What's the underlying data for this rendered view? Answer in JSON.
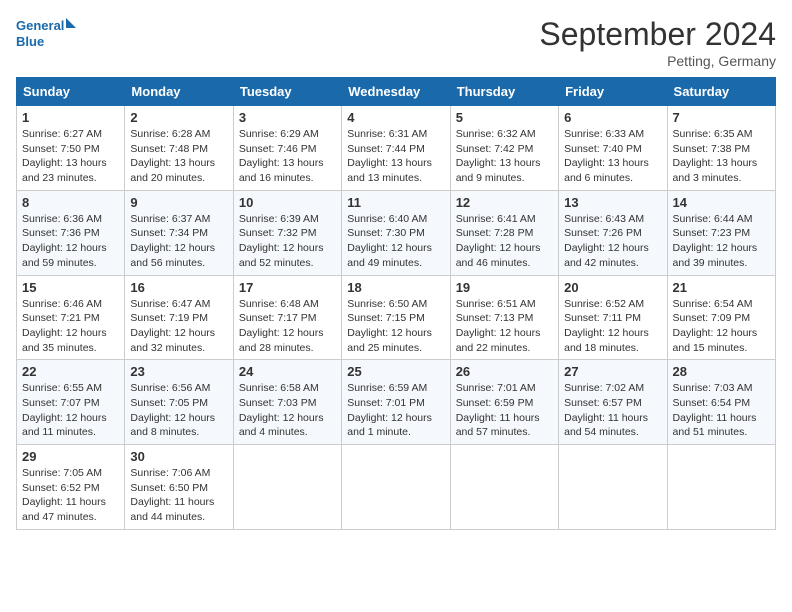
{
  "header": {
    "logo_line1": "General",
    "logo_line2": "Blue",
    "month_title": "September 2024",
    "location": "Petting, Germany"
  },
  "days_of_week": [
    "Sunday",
    "Monday",
    "Tuesday",
    "Wednesday",
    "Thursday",
    "Friday",
    "Saturday"
  ],
  "weeks": [
    [
      {
        "day": "1",
        "info": "Sunrise: 6:27 AM\nSunset: 7:50 PM\nDaylight: 13 hours\nand 23 minutes."
      },
      {
        "day": "2",
        "info": "Sunrise: 6:28 AM\nSunset: 7:48 PM\nDaylight: 13 hours\nand 20 minutes."
      },
      {
        "day": "3",
        "info": "Sunrise: 6:29 AM\nSunset: 7:46 PM\nDaylight: 13 hours\nand 16 minutes."
      },
      {
        "day": "4",
        "info": "Sunrise: 6:31 AM\nSunset: 7:44 PM\nDaylight: 13 hours\nand 13 minutes."
      },
      {
        "day": "5",
        "info": "Sunrise: 6:32 AM\nSunset: 7:42 PM\nDaylight: 13 hours\nand 9 minutes."
      },
      {
        "day": "6",
        "info": "Sunrise: 6:33 AM\nSunset: 7:40 PM\nDaylight: 13 hours\nand 6 minutes."
      },
      {
        "day": "7",
        "info": "Sunrise: 6:35 AM\nSunset: 7:38 PM\nDaylight: 13 hours\nand 3 minutes."
      }
    ],
    [
      {
        "day": "8",
        "info": "Sunrise: 6:36 AM\nSunset: 7:36 PM\nDaylight: 12 hours\nand 59 minutes."
      },
      {
        "day": "9",
        "info": "Sunrise: 6:37 AM\nSunset: 7:34 PM\nDaylight: 12 hours\nand 56 minutes."
      },
      {
        "day": "10",
        "info": "Sunrise: 6:39 AM\nSunset: 7:32 PM\nDaylight: 12 hours\nand 52 minutes."
      },
      {
        "day": "11",
        "info": "Sunrise: 6:40 AM\nSunset: 7:30 PM\nDaylight: 12 hours\nand 49 minutes."
      },
      {
        "day": "12",
        "info": "Sunrise: 6:41 AM\nSunset: 7:28 PM\nDaylight: 12 hours\nand 46 minutes."
      },
      {
        "day": "13",
        "info": "Sunrise: 6:43 AM\nSunset: 7:26 PM\nDaylight: 12 hours\nand 42 minutes."
      },
      {
        "day": "14",
        "info": "Sunrise: 6:44 AM\nSunset: 7:23 PM\nDaylight: 12 hours\nand 39 minutes."
      }
    ],
    [
      {
        "day": "15",
        "info": "Sunrise: 6:46 AM\nSunset: 7:21 PM\nDaylight: 12 hours\nand 35 minutes."
      },
      {
        "day": "16",
        "info": "Sunrise: 6:47 AM\nSunset: 7:19 PM\nDaylight: 12 hours\nand 32 minutes."
      },
      {
        "day": "17",
        "info": "Sunrise: 6:48 AM\nSunset: 7:17 PM\nDaylight: 12 hours\nand 28 minutes."
      },
      {
        "day": "18",
        "info": "Sunrise: 6:50 AM\nSunset: 7:15 PM\nDaylight: 12 hours\nand 25 minutes."
      },
      {
        "day": "19",
        "info": "Sunrise: 6:51 AM\nSunset: 7:13 PM\nDaylight: 12 hours\nand 22 minutes."
      },
      {
        "day": "20",
        "info": "Sunrise: 6:52 AM\nSunset: 7:11 PM\nDaylight: 12 hours\nand 18 minutes."
      },
      {
        "day": "21",
        "info": "Sunrise: 6:54 AM\nSunset: 7:09 PM\nDaylight: 12 hours\nand 15 minutes."
      }
    ],
    [
      {
        "day": "22",
        "info": "Sunrise: 6:55 AM\nSunset: 7:07 PM\nDaylight: 12 hours\nand 11 minutes."
      },
      {
        "day": "23",
        "info": "Sunrise: 6:56 AM\nSunset: 7:05 PM\nDaylight: 12 hours\nand 8 minutes."
      },
      {
        "day": "24",
        "info": "Sunrise: 6:58 AM\nSunset: 7:03 PM\nDaylight: 12 hours\nand 4 minutes."
      },
      {
        "day": "25",
        "info": "Sunrise: 6:59 AM\nSunset: 7:01 PM\nDaylight: 12 hours\nand 1 minute."
      },
      {
        "day": "26",
        "info": "Sunrise: 7:01 AM\nSunset: 6:59 PM\nDaylight: 11 hours\nand 57 minutes."
      },
      {
        "day": "27",
        "info": "Sunrise: 7:02 AM\nSunset: 6:57 PM\nDaylight: 11 hours\nand 54 minutes."
      },
      {
        "day": "28",
        "info": "Sunrise: 7:03 AM\nSunset: 6:54 PM\nDaylight: 11 hours\nand 51 minutes."
      }
    ],
    [
      {
        "day": "29",
        "info": "Sunrise: 7:05 AM\nSunset: 6:52 PM\nDaylight: 11 hours\nand 47 minutes."
      },
      {
        "day": "30",
        "info": "Sunrise: 7:06 AM\nSunset: 6:50 PM\nDaylight: 11 hours\nand 44 minutes."
      },
      {
        "day": "",
        "info": ""
      },
      {
        "day": "",
        "info": ""
      },
      {
        "day": "",
        "info": ""
      },
      {
        "day": "",
        "info": ""
      },
      {
        "day": "",
        "info": ""
      }
    ]
  ]
}
